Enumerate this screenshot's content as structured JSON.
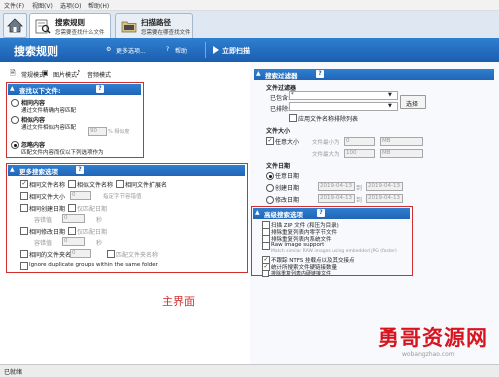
{
  "menu": [
    "文件(F)",
    "视图(V)",
    "选项(O)",
    "帮助(H)"
  ],
  "tabs": [
    {
      "title": "搜索规则",
      "subtitle": "您需要查找什么文件"
    },
    {
      "title": "扫描路径",
      "subtitle": "您需要在哪查找文件"
    }
  ],
  "header": {
    "title": "搜索规则",
    "more_options": "更多选项...",
    "help": "帮助",
    "start_scan": "立即扫描"
  },
  "modes": [
    "常规模式",
    "图片模式",
    "音频模式"
  ],
  "find_section": {
    "title": "查找以下文件:",
    "options": [
      {
        "label": "相同内容",
        "desc": "通过文件精确内容匹配",
        "selected": false
      },
      {
        "label": "相似内容",
        "desc": "通过文件相似内容匹配",
        "selected": false
      },
      {
        "label": "忽略内容",
        "desc": "匹配文件内容而仅以下列选项作为",
        "selected": true
      }
    ],
    "similarity_value": "90",
    "similarity_unit": "% 相似度"
  },
  "more_section": {
    "title": "更多搜索选项",
    "row1": [
      {
        "label": "相同文件名称",
        "checked": true
      },
      {
        "label": "相似文件名称",
        "checked": false
      },
      {
        "label": "相同文件扩展名",
        "checked": false
      }
    ],
    "same_size": {
      "label": "相同文件大小",
      "value": "0",
      "note": "指定字节容错值"
    },
    "same_created": {
      "label": "相同创建日期",
      "note": "仅匹配日期"
    },
    "created_tolerance": {
      "label": "容错值",
      "value": "0",
      "unit": "秒"
    },
    "same_modified": {
      "label": "相同修改日期",
      "note": "仅匹配日期"
    },
    "modified_tolerance": {
      "label": "容错值",
      "value": "0",
      "unit": "秒"
    },
    "same_folder": {
      "label": "相同的文件夹名",
      "value": "0",
      "note": "匹配文件夹名称"
    },
    "ignore_groups": "Ignore duplicate groups within the same folder"
  },
  "filter_section": {
    "title": "搜索过滤器",
    "file_filter": {
      "title": "文件过滤器",
      "include_label": "已包含:",
      "include_value": "*",
      "exclude_label": "已排除:",
      "select_button": "选择",
      "apply_exclude": "应用文件名称排除列表"
    },
    "file_size": {
      "title": "文件大小",
      "any_size": "任意大小",
      "min_label": "文件最小为",
      "min_value": "0",
      "min_unit": "MB",
      "max_label": "文件最大为",
      "max_value": "100",
      "max_unit": "MB"
    },
    "file_date": {
      "title": "文件日期",
      "any_date": "任意日期",
      "created": "创建日期",
      "created_date": "2019-04-13",
      "modified": "修改日期",
      "modified_date": "2019-04-13",
      "to": "到"
    }
  },
  "advanced_section": {
    "title": "高级搜索选项",
    "items": [
      {
        "label": "扫描 ZIP 文件 (和压为目录)",
        "checked": false
      },
      {
        "label": "排除重复列表内零字节文件",
        "checked": false
      },
      {
        "label": "排除重复列表内系统文件",
        "checked": false
      },
      {
        "label": "Raw image support",
        "checked": false
      },
      {
        "label": "Match similar RAW images using embedded JPG (faster)",
        "checked": false
      },
      {
        "label": "不跟踪 NTFS 挂载点以及其交接点",
        "checked": true
      },
      {
        "label": "统计所搜索文件硬链接数量",
        "checked": true
      },
      {
        "label": "排除重复列表内硬链接文件",
        "checked": false
      }
    ]
  },
  "main_label": "主界面",
  "status": "已就绪",
  "watermark": {
    "text": "勇哥资源网",
    "url": "wobangzhao.com"
  }
}
